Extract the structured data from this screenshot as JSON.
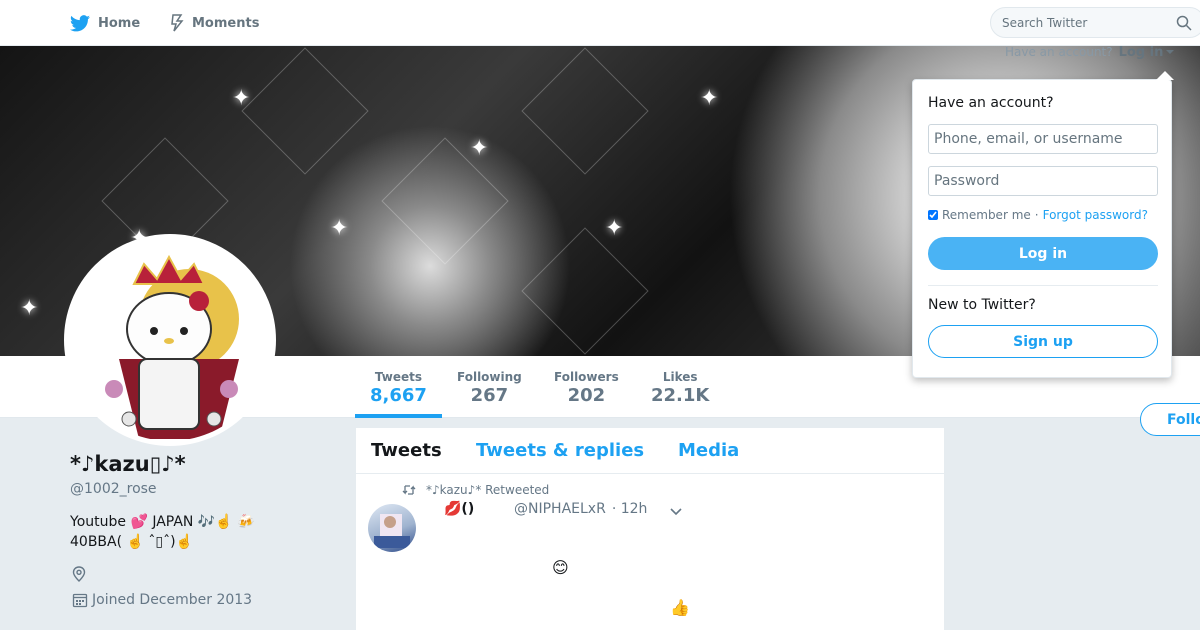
{
  "topnav": {
    "home_label": "Home",
    "moments_label": "Moments",
    "search_placeholder": "Search Twitter"
  },
  "login_bar": {
    "prompt": "Have an account?",
    "login_label": "Log in"
  },
  "login_dropdown": {
    "title": "Have an account?",
    "username_placeholder": "Phone, email, or username",
    "password_placeholder": "Password",
    "remember_label": "Remember me",
    "separator": "·",
    "forgot_label": "Forgot password?",
    "login_button": "Log in",
    "new_label": "New to Twitter?",
    "signup_button": "Sign up"
  },
  "stats": [
    {
      "label": "Tweets",
      "value": "8,667"
    },
    {
      "label": "Following",
      "value": "267"
    },
    {
      "label": "Followers",
      "value": "202"
    },
    {
      "label": "Likes",
      "value": "22.1K"
    }
  ],
  "follow_button": "Follo",
  "profile": {
    "name": "*♪kazu▯♪*",
    "screen_name": "@1002_rose",
    "bio_line1": "Youtube 💕 JAPAN  🎶☝️   🍻",
    "bio_line2": "40BBA(          ☝️ ˆ▯ˆ)☝️",
    "joined": "Joined December 2013"
  },
  "timeline": {
    "tabs": [
      "Tweets",
      "Tweets & replies",
      "Media"
    ],
    "retweet_context": "*♪kazu♪* Retweeted",
    "tweet": {
      "fullname": "💋()",
      "handle": "@NIPHAELxR",
      "time": "· 12h",
      "emoji_1": "😊",
      "emoji_2": "👍"
    }
  },
  "colors": {
    "brand_blue": "#1da1f2",
    "login_button": "#4ab3f4",
    "page_background": "#e6ecf0"
  }
}
